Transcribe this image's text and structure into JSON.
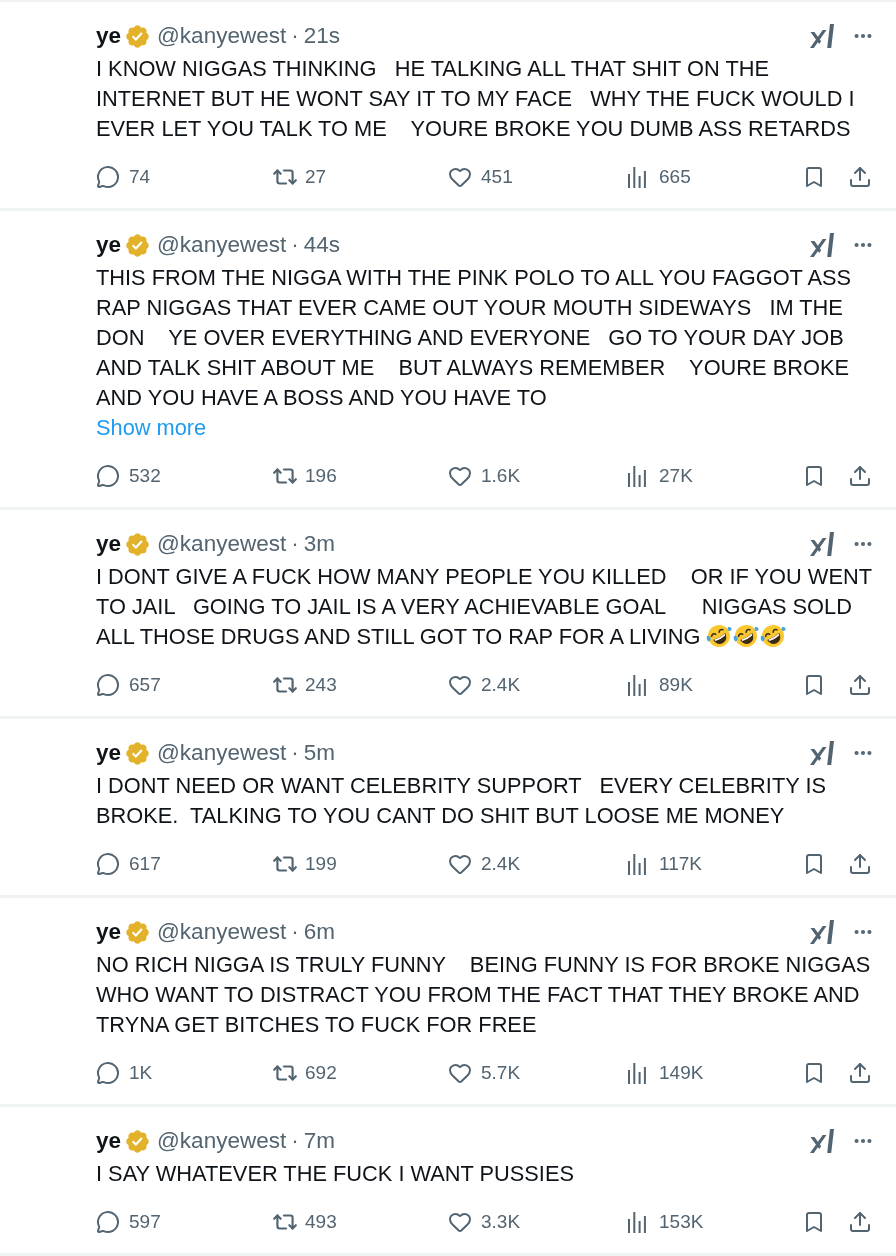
{
  "tweets": [
    {
      "name": "ye",
      "verified": true,
      "handle": "@kanyewest",
      "separator": "·",
      "time": "21s",
      "text": "I KNOW NIGGAS THINKING   HE TALKING ALL THAT SHIT ON THE INTERNET BUT HE WONT SAY IT TO MY FACE   WHY THE FUCK WOULD I EVER LET YOU TALK TO ME    YOURE BROKE YOU DUMB ASS RETARDS",
      "stats": {
        "replies": "74",
        "reposts": "27",
        "likes": "451",
        "views": "665"
      }
    },
    {
      "name": "ye",
      "verified": true,
      "handle": "@kanyewest",
      "separator": "·",
      "time": "44s",
      "text": "THIS FROM THE NIGGA WITH THE PINK POLO TO ALL YOU FAGGOT ASS RAP NIGGAS THAT EVER CAME OUT YOUR MOUTH SIDEWAYS   IM THE DON    YE OVER EVERYTHING AND EVERYONE   GO TO YOUR DAY JOB AND TALK SHIT ABOUT ME    BUT ALWAYS REMEMBER    YOURE BROKE AND YOU HAVE A BOSS AND YOU HAVE TO",
      "show_more": "Show more",
      "stats": {
        "replies": "532",
        "reposts": "196",
        "likes": "1.6K",
        "views": "27K"
      }
    },
    {
      "name": "ye",
      "verified": true,
      "handle": "@kanyewest",
      "separator": "·",
      "time": "3m",
      "text": "I DONT GIVE A FUCK HOW MANY PEOPLE YOU KILLED    OR IF YOU WENT TO JAIL   GOING TO JAIL IS A VERY ACHIEVABLE GOAL      NIGGAS SOLD ALL THOSE DRUGS AND STILL GOT TO RAP FOR A LIVING",
      "emojis": [
        {
          "kind": "rofl"
        },
        {
          "kind": "rofl"
        },
        {
          "kind": "rofl"
        }
      ],
      "stats": {
        "replies": "657",
        "reposts": "243",
        "likes": "2.4K",
        "views": "89K"
      }
    },
    {
      "name": "ye",
      "verified": true,
      "handle": "@kanyewest",
      "separator": "·",
      "time": "5m",
      "text": "I DONT NEED OR WANT CELEBRITY SUPPORT   EVERY CELEBRITY IS BROKE.  TALKING TO YOU CANT DO SHIT BUT LOOSE ME MONEY",
      "stats": {
        "replies": "617",
        "reposts": "199",
        "likes": "2.4K",
        "views": "117K"
      }
    },
    {
      "name": "ye",
      "verified": true,
      "handle": "@kanyewest",
      "separator": "·",
      "time": "6m",
      "text": "NO RICH NIGGA IS TRULY FUNNY    BEING FUNNY IS FOR BROKE NIGGAS WHO WANT TO DISTRACT YOU FROM THE FACT THAT THEY BROKE AND TRYNA GET BITCHES TO FUCK FOR FREE",
      "stats": {
        "replies": "1K",
        "reposts": "692",
        "likes": "5.7K",
        "views": "149K"
      }
    },
    {
      "name": "ye",
      "verified": true,
      "handle": "@kanyewest",
      "separator": "·",
      "time": "7m",
      "text": "I SAY WHATEVER THE FUCK I WANT PUSSIES",
      "stats": {
        "replies": "597",
        "reposts": "493",
        "likes": "3.3K",
        "views": "153K"
      }
    }
  ]
}
